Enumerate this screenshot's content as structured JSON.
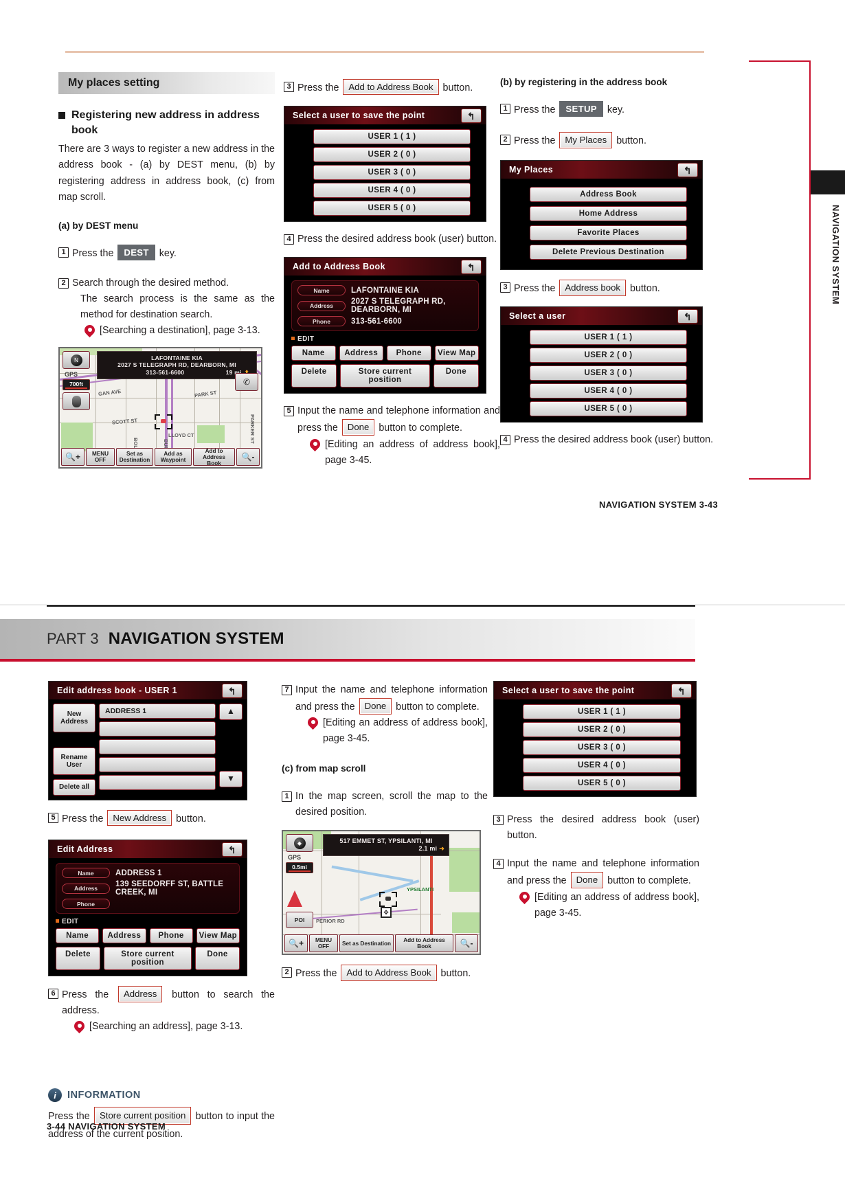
{
  "top_page": {
    "side_tab_label": "NAVIGATION SYSTEM",
    "footer": "NAVIGATION SYSTEM   3-43",
    "section_title": "My places setting",
    "bullet_title": "Registering new address in address book",
    "intro_paragraph": "There are 3 ways to register a new address in the address book - (a) by DEST menu, (b) by registering address in address book, (c) from map scroll.",
    "subhead_a": "(a) by DEST menu",
    "a_step1_pre": "Press the",
    "a_step1_key": "DEST",
    "a_step1_post": "key.",
    "a_step2_line1": "Search through the desired method.",
    "a_step2_line2": "The search process is the same as the method for destination search.",
    "a_step2_ref": "[Searching a destination], page 3-13.",
    "map1": {
      "banner_line1": "LAFONTAINE KIA",
      "banner_line2": "2027 S TELEGRAPH RD, DEARBORN, MI",
      "banner_phone": "313-561-6600",
      "banner_distance": "19 mi",
      "gps_label": "GPS",
      "scale": "700ft",
      "compass_letter": "N",
      "streets": [
        "GAN AVE",
        "PARK ST",
        "SCOTT ST",
        "LLOYD CT",
        "BURNS",
        "BOLD",
        "PARKER ST"
      ],
      "bar_buttons": [
        "MENU OFF",
        "Set as Destination",
        "Add as Waypoint",
        "Add to Address Book"
      ]
    },
    "b_step3_pre": "Press the",
    "b_step3_btn": "Add to Address Book",
    "b_step3_post": "button.",
    "select_user_screen": {
      "title": "Select a user to save the point",
      "users": [
        "USER 1 ( 1 )",
        "USER 2 ( 0 )",
        "USER 3 ( 0 )",
        "USER 4 ( 0 )",
        "USER 5 ( 0 )"
      ]
    },
    "step4_text": "Press the desired address book (user) button.",
    "add_to_address_book_screen": {
      "title": "Add to Address Book",
      "edit_label": "EDIT",
      "fields": [
        {
          "label": "Name",
          "value": "LAFONTAINE KIA"
        },
        {
          "label": "Address",
          "value": "2027 S TELEGRAPH RD, DEARBORN, MI"
        },
        {
          "label": "Phone",
          "value": "313-561-6600"
        }
      ],
      "buttons_row1": [
        "Name",
        "Address",
        "Phone",
        "View Map"
      ],
      "buttons_row2": [
        "Delete",
        "Store current position",
        "Done"
      ]
    },
    "step5_pre": "Input the name and telephone information and press the",
    "step5_btn": "Done",
    "step5_post": "button to complete.",
    "step5_ref": "[Editing an address of address book], page 3-45.",
    "subhead_b": "(b) by registering in the address book",
    "b_step1_pre": "Press the",
    "b_step1_key": "SETUP",
    "b_step1_post": "key.",
    "b_step2_pre": "Press the",
    "b_step2_btn": "My Places",
    "b_step2_post": "button.",
    "my_places_screen": {
      "title": "My Places",
      "items": [
        "Address Book",
        "Home Address",
        "Favorite Places",
        "Delete Previous Destination"
      ]
    },
    "b_step3b_pre": "Press the",
    "b_step3b_btn": "Address book",
    "b_step3b_post": "button.",
    "select_a_user_screen": {
      "title": "Select a user",
      "users": [
        "USER 1 ( 1 )",
        "USER 2 ( 0 )",
        "USER 3 ( 0 )",
        "USER 4 ( 0 )",
        "USER 5 ( 0 )"
      ]
    },
    "b_step4_text": "Press the desired address book (user) button."
  },
  "bottom_page": {
    "part_label": "PART 3",
    "part_title": "NAVIGATION SYSTEM",
    "footer": "3-44  NAVIGATION SYSTEM",
    "edit_address_book_screen": {
      "title": "Edit address book - USER 1",
      "left_buttons": [
        "New Address",
        "Rename User",
        "Delete all"
      ],
      "slots": [
        "ADDRESS 1",
        "",
        "",
        "",
        ""
      ],
      "scroll_up": "▲",
      "scroll_down": "▼"
    },
    "step5_pre": "Press the",
    "step5_btn": "New Address",
    "step5_post": "button.",
    "edit_address_screen": {
      "title": "Edit Address",
      "edit_label": "EDIT",
      "fields": [
        {
          "label": "Name",
          "value": "ADDRESS 1"
        },
        {
          "label": "Address",
          "value": "139 SEEDORFF ST, BATTLE CREEK, MI"
        },
        {
          "label": "Phone",
          "value": ""
        }
      ],
      "buttons_row1": [
        "Name",
        "Address",
        "Phone",
        "View Map"
      ],
      "buttons_row2": [
        "Delete",
        "Store current position",
        "Done"
      ]
    },
    "step6_pre": "Press the",
    "step6_btn": "Address",
    "step6_post": "button to search the address.",
    "step6_ref": "[Searching an address], page 3-13.",
    "information": {
      "title": "INFORMATION",
      "pre": "Press the",
      "btn": "Store current position",
      "post": "button to input the address of the current position."
    },
    "step7_pre": "Input the name and telephone information and press the",
    "step7_btn": "Done",
    "step7_post": "button to complete.",
    "step7_ref": "[Editing an address of address book], page 3-45.",
    "subhead_c": "(c) from map scroll",
    "c_step1_text": "In the map screen, scroll the map to the desired position.",
    "map2": {
      "banner_line1": "517 EMMET ST, YPSILANTI, MI",
      "banner_distance": "2.1 mi",
      "gps_label": "GPS",
      "scale": "0.5mi",
      "poi_label": "POI",
      "streets": [
        "YPSILANTI",
        "PERIOR RD"
      ],
      "bar_buttons": [
        "MENU OFF",
        "Set as Destination",
        "Add to Address Book"
      ]
    },
    "c_step2_pre": "Press the",
    "c_step2_btn": "Add to Address Book",
    "c_step2_post": "button.",
    "select_user_save_screen": {
      "title": "Select a user to save the point",
      "users": [
        "USER 1 ( 1 )",
        "USER 2 ( 0 )",
        "USER 3 ( 0 )",
        "USER 4 ( 0 )",
        "USER 5 ( 0 )"
      ]
    },
    "c_step3_text": "Press the desired address book (user) button.",
    "c_step4_pre": "Input the name and telephone information and press the",
    "c_step4_btn": "Done",
    "c_step4_post": "button to complete.",
    "c_step4_ref": "[Editing an address of address book], page 3-45."
  },
  "numerals": {
    "n1": "1",
    "n2": "2",
    "n3": "3",
    "n4": "4",
    "n5": "5",
    "n6": "6",
    "n7": "7"
  }
}
